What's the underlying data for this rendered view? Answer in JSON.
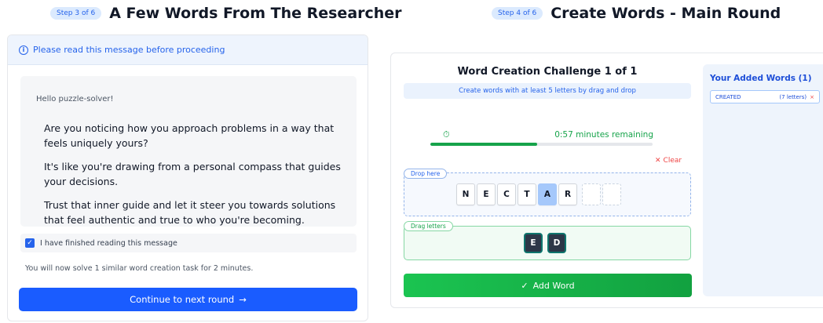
{
  "left": {
    "step_badge": "Step 3 of 6",
    "title": "A Few Words From The Researcher",
    "notice": "Please read this message before proceeding",
    "greeting": "Hello puzzle-solver!",
    "paragraphs": [
      "Are you noticing how you approach problems in a way that feels uniquely yours?",
      "It's like you're drawing from a personal compass that guides your decisions.",
      "Trust that inner guide and let it steer you towards solutions that feel authentic and true to who you're becoming."
    ],
    "checkbox_label": "I have finished reading this message",
    "checkbox_checked": true,
    "note": "You will now solve 1 similar word creation task for 2 minutes.",
    "continue_label": "Continue to next round",
    "continue_icon": "arrow-right-icon"
  },
  "right": {
    "step_badge": "Step 4 of 6",
    "title": "Create Words - Main Round",
    "challenge_title": "Word Creation Challenge 1 of 1",
    "instructions": "Create words with at least 5 letters by drag and drop",
    "timer_text": "0:57 minutes remaining",
    "timer_progress": 0.48,
    "clear_label": "Clear",
    "drop_label": "Drop here",
    "drop_tiles": [
      "N",
      "E",
      "C",
      "T",
      "A",
      "R"
    ],
    "selected_tile_index": 4,
    "empty_slots": 2,
    "drag_label": "Drag letters",
    "drag_tiles": [
      "E",
      "D"
    ],
    "add_label": "Add Word",
    "added_title": "Your Added Words (1)",
    "added_words": [
      {
        "word": "CREATED",
        "meta": "(7 letters)"
      }
    ]
  },
  "colors": {
    "primary_blue": "#1a5cff",
    "success_green": "#16a34a",
    "danger_red": "#ef4444",
    "dark_tile": "#2d3748"
  }
}
